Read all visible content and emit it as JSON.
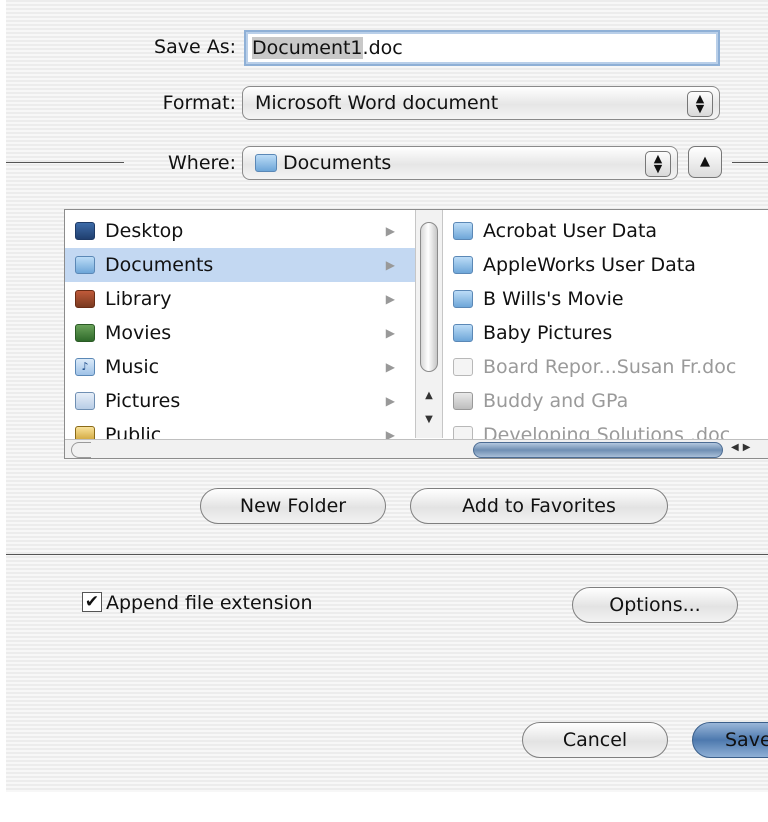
{
  "save_as": {
    "label": "Save As:",
    "selected_part": "Document1",
    "rest": ".doc"
  },
  "format": {
    "label": "Format:",
    "value": "Microsoft Word document"
  },
  "where": {
    "label": "Where:",
    "value": "Documents"
  },
  "sidebar_items": [
    {
      "label": "Desktop",
      "icon": "desktop-icon"
    },
    {
      "label": "Documents",
      "icon": "folder-icon",
      "selected": true
    },
    {
      "label": "Library",
      "icon": "library-icon"
    },
    {
      "label": "Movies",
      "icon": "movies-icon"
    },
    {
      "label": "Music",
      "icon": "music-icon"
    },
    {
      "label": "Pictures",
      "icon": "pictures-icon"
    },
    {
      "label": "Public",
      "icon": "public-icon"
    }
  ],
  "file_items": [
    {
      "label": "Acrobat User Data",
      "type": "folder"
    },
    {
      "label": "AppleWorks User Data",
      "type": "folder"
    },
    {
      "label": "B Wills's Movie",
      "type": "folder"
    },
    {
      "label": "Baby Pictures",
      "type": "folder"
    },
    {
      "label": "Board Repor...Susan Fr.doc",
      "type": "document",
      "dimmed": true
    },
    {
      "label": "Buddy and GPa",
      "type": "image",
      "dimmed": true
    },
    {
      "label": "Developing Solutions .doc",
      "type": "document",
      "dimmed": true
    }
  ],
  "buttons": {
    "new_folder": "New Folder",
    "add_to_favorites": "Add to Favorites",
    "options": "Options...",
    "cancel": "Cancel",
    "save": "Save"
  },
  "append_extension": {
    "label": "Append file extension",
    "checked": true
  },
  "colors": {
    "selection": "#c3d8f2",
    "default_button": "#4d79ae"
  }
}
